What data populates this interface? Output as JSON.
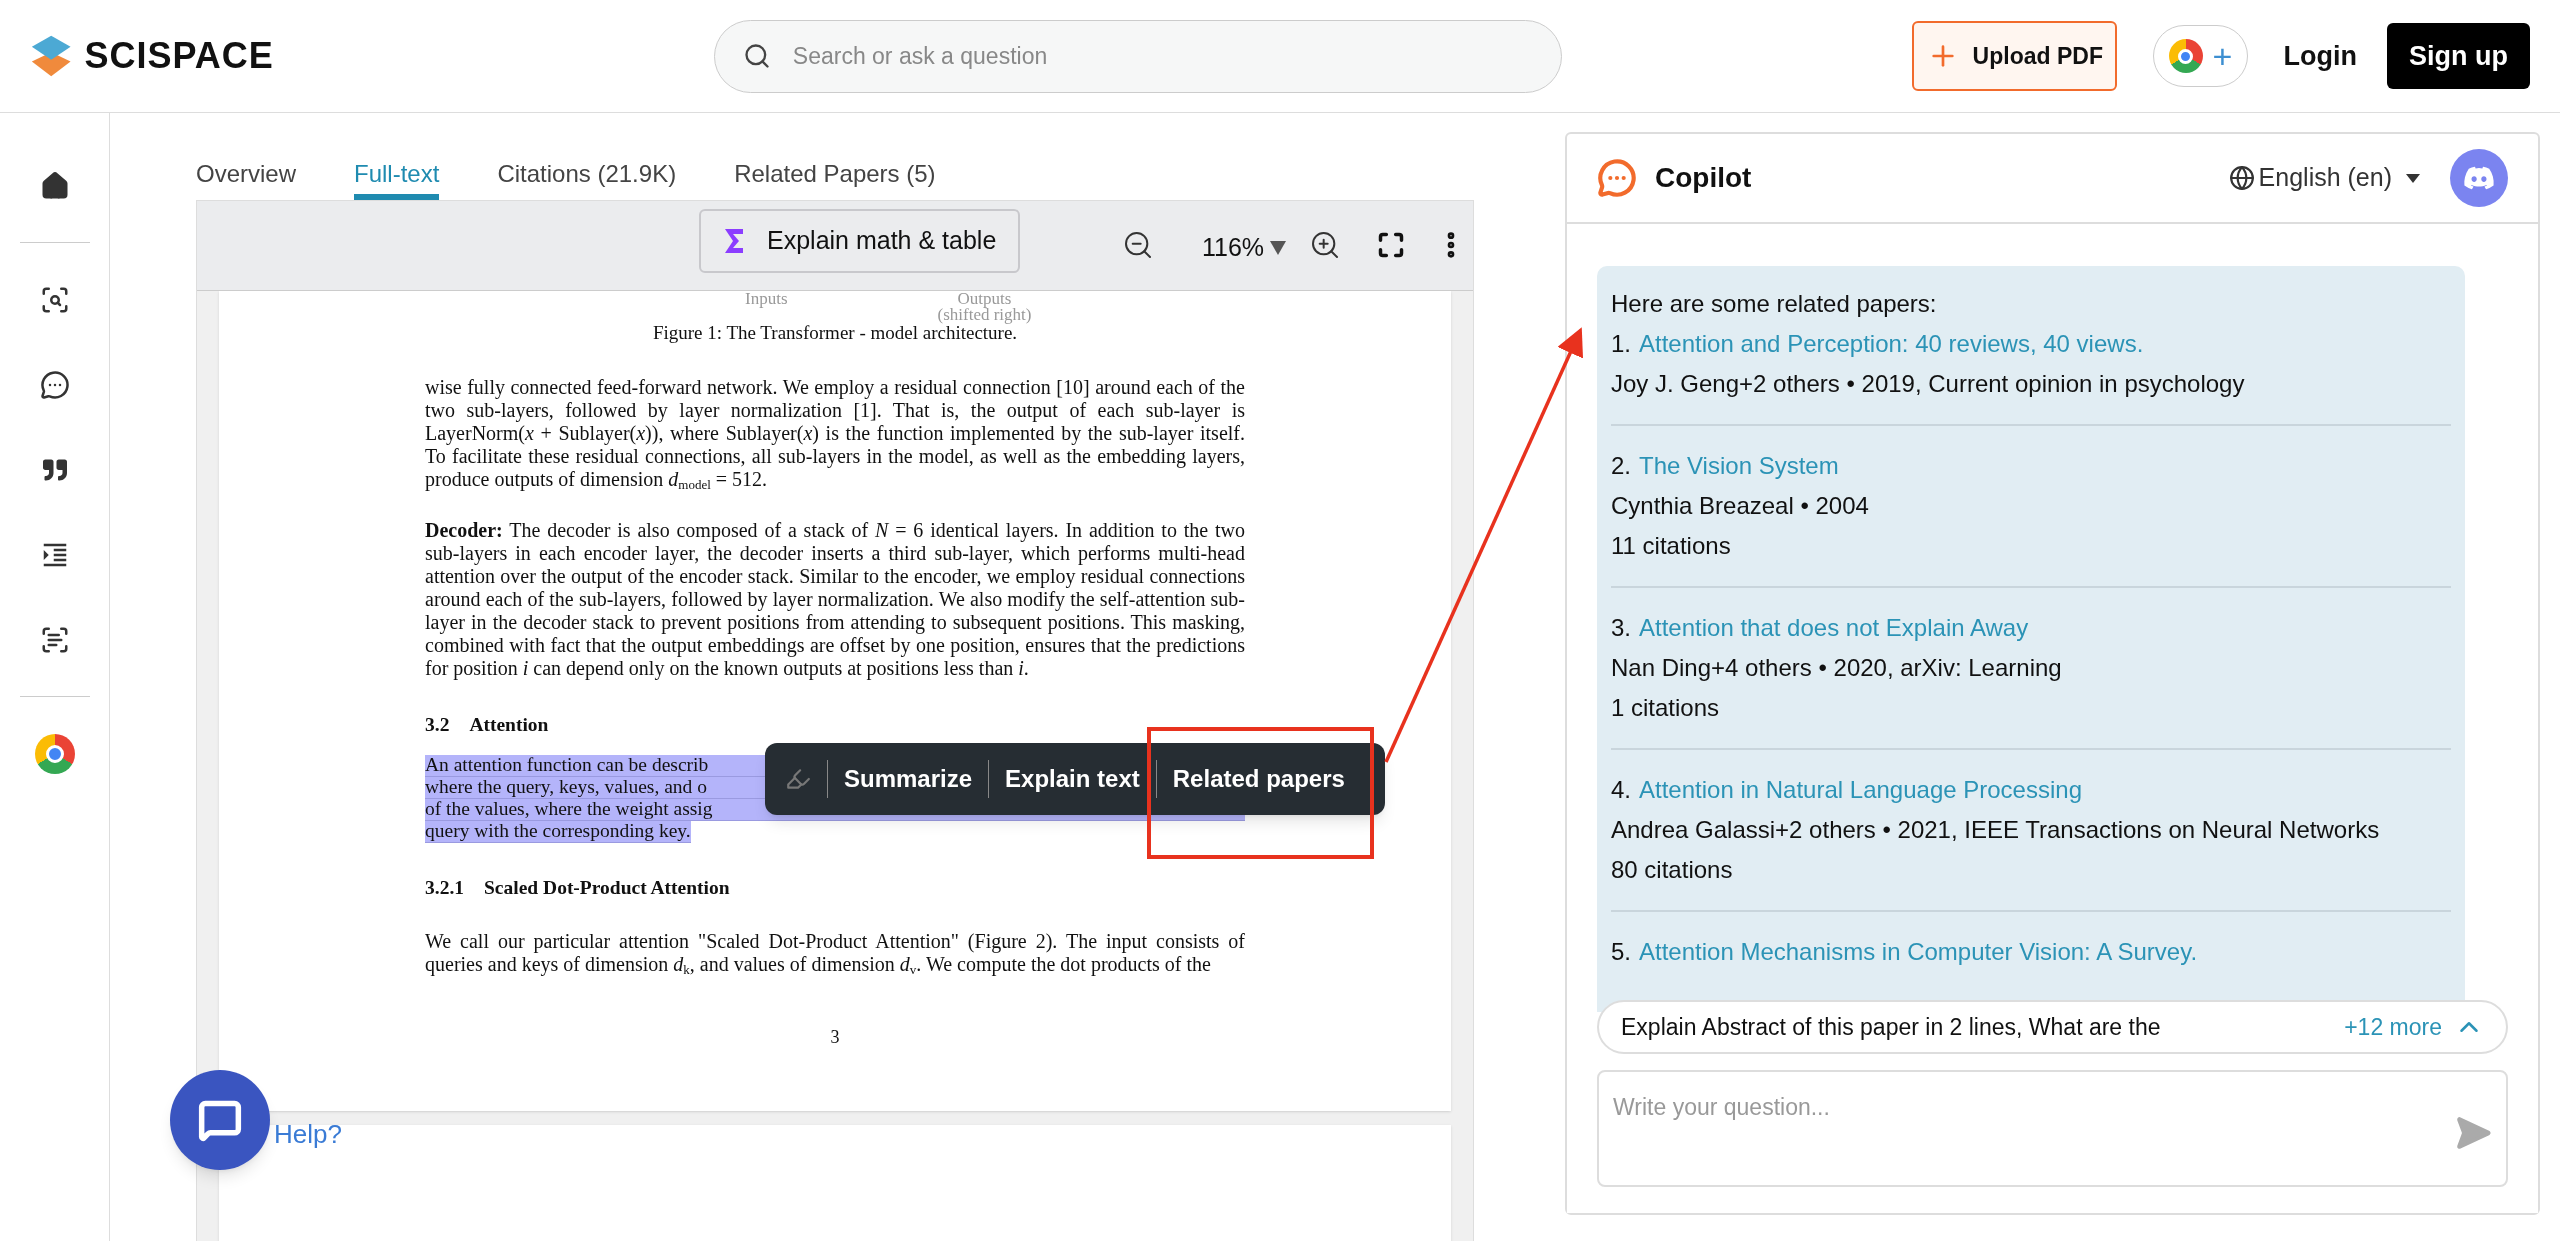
{
  "header": {
    "logo": "SCISPACE",
    "search": {
      "placeholder": "Search or ask a question"
    },
    "upload_button": "Upload PDF",
    "extension_button": "+",
    "login": "Login",
    "signup": "Sign up"
  },
  "tabs": [
    {
      "label": "Overview",
      "selected": false
    },
    {
      "label": "Full-text",
      "selected": true
    },
    {
      "label": "Citations (21.9K)",
      "selected": false
    },
    {
      "label": "Related Papers (5)",
      "selected": false
    }
  ],
  "viewer": {
    "explain_button": "Explain math & table",
    "zoom": "116%",
    "figure_labels": [
      "Inputs",
      "Outputs",
      "(shifted right)"
    ],
    "blocks": [
      {
        "kind": "caption",
        "text": "Figure 1: The Transformer - model architecture."
      },
      {
        "kind": "paragraph",
        "text": "wise fully connected feed-forward network. We employ a residual connection [10] around each of the two sub-layers, followed by layer normalization [1]. That is, the output of each sub-layer is LayerNorm(*x* + Sublayer(*x*)), where Sublayer(*x*) is the function implemented by the sub-layer itself. To facilitate these residual connections, all sub-layers in the model, as well as the embedding layers, produce outputs of dimension *d*$_{model}$ = 512."
      },
      {
        "kind": "paragraph",
        "text": "**Decoder:**   The decoder is also composed of a stack of *N* = 6 identical layers. In addition to the two sub-layers in each encoder layer, the decoder inserts a third sub-layer, which performs multi-head attention over the output of the encoder stack. Similar to the encoder, we employ residual connections around each of the sub-layers, followed by layer normalization. We also modify the self-attention sub-layer in the decoder stack to prevent positions from attending to subsequent positions. This masking, combined with fact that the output embeddings are offset by one position, ensures that the predictions for position *i* can depend only on the known outputs at positions less than *i*."
      },
      {
        "kind": "heading",
        "number": "3.2",
        "text": "Attention"
      },
      {
        "kind": "highlight",
        "lines": [
          "An attention function can be describ",
          "where the query, keys, values, and o",
          "of the values, where the weight assig",
          "query with the corresponding key."
        ]
      },
      {
        "kind": "heading",
        "number": "3.2.1",
        "text": "Scaled Dot-Product Attention"
      },
      {
        "kind": "paragraph",
        "text": "We call our particular attention \"Scaled Dot-Product Attention\" (Figure 2). The input consists of queries and keys of dimension *d*$_{k}$, and values of dimension *d*$_{v}$. We compute the dot products of the"
      },
      {
        "kind": "page_number",
        "text": "3"
      }
    ],
    "popup_actions": [
      "Summarize",
      "Explain text",
      "Related papers"
    ]
  },
  "help": "Help?",
  "copilot": {
    "title": "Copilot",
    "language": "English (en)",
    "intro": "Here are some related papers:",
    "papers": [
      {
        "number": "1.",
        "title": "Attention and Perception: 40 reviews, 40 views.",
        "meta": "Joy J. Geng+2 others • 2019, Current opinion in psychology"
      },
      {
        "number": "2.",
        "title": "The Vision System",
        "meta": "Cynthia Breazeal • 2004",
        "citations": "11 citations"
      },
      {
        "number": "3.",
        "title": "Attention that does not Explain Away",
        "meta": "Nan Ding+4 others • 2020, arXiv: Learning",
        "citations": "1 citations"
      },
      {
        "number": "4.",
        "title": "Attention in Natural Language Processing",
        "meta": "Andrea Galassi+2 others • 2021, IEEE Transactions on Neural Networks",
        "citations": "80 citations"
      },
      {
        "number": "5.",
        "title": "Attention Mechanisms in Computer Vision: A Survey."
      }
    ],
    "suggestion": "Explain Abstract of this paper in 2 lines, What are the",
    "more": "+12 more",
    "input": {
      "placeholder": "Write your question..."
    }
  }
}
